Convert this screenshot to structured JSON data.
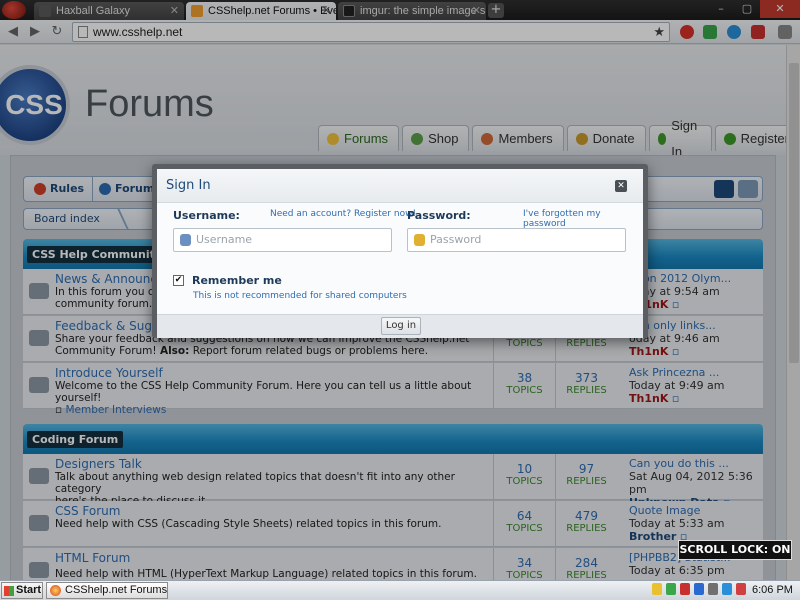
{
  "browser": {
    "tabs": [
      {
        "title": "Haxball Galaxy",
        "favicon_color": "#5a5a5a"
      },
      {
        "title": "CSShelp.net Forums • Every",
        "favicon_color": "#f0a030"
      },
      {
        "title": "imgur: the simple image sh",
        "favicon_color": "#222222"
      }
    ],
    "new_tab_symbol": "+",
    "window_controls": {
      "minimize": "–",
      "maximize": "▢",
      "close": "✕"
    },
    "nav": {
      "back": "◀",
      "forward": "▶",
      "reload": "↻"
    },
    "url": "www.csshelp.net",
    "star_symbol": "★"
  },
  "site": {
    "logo_badge": "CSS",
    "logo_text": "Forums",
    "nav": [
      {
        "label": "Forums",
        "icon": "chat-icon",
        "color": "#f2c33a"
      },
      {
        "label": "Shop",
        "icon": "tag-icon",
        "color": "#5aa04a"
      },
      {
        "label": "Members",
        "icon": "members-icon",
        "color": "#d06a3a"
      },
      {
        "label": "Donate",
        "icon": "coins-icon",
        "color": "#c89a2a"
      },
      {
        "label": "Sign In",
        "icon": "check-icon",
        "color": "#3c9a2a"
      },
      {
        "label": "Register",
        "icon": "plus-icon",
        "color": "#3c9a2a"
      }
    ],
    "subnav": {
      "rules": "Rules",
      "forum": "Forum"
    },
    "breadcrumb": "Board index"
  },
  "categories": [
    {
      "title": "CSS Help Community F",
      "forums": [
        {
          "name": "News & Announcem",
          "desc": "In this forum you can",
          "desc2": "community forum.",
          "topics": "",
          "replies": "",
          "last_title": "ndon 2012 Olym...",
          "last_when": "oday at 9:54 am",
          "last_user": "Th1nK"
        },
        {
          "name": "Feedback & Sugges",
          "desc": "Share your feedback and suggestions on how we can improve the CSShelp.net",
          "desc2": "Community Forum!",
          "also_label": "Also:",
          "also_text": "Report forum related bugs or problems here.",
          "topics": "20",
          "replies": "157",
          "last_title": "min only links...",
          "last_when": "oday at 9:46 am",
          "last_user": "Th1nK"
        },
        {
          "name": "Introduce Yourself",
          "desc": "Welcome to the CSS Help Community Forum. Here you can tell us a little about yourself!",
          "subforum": "Member Interviews",
          "topics": "38",
          "replies": "373",
          "last_title": "Ask Princezna ...",
          "last_when": "Today at 9:49 am",
          "last_user": "Th1nK"
        }
      ]
    },
    {
      "title": "Coding Forum",
      "forums": [
        {
          "name": "Designers Talk",
          "desc": "Talk about anything web design related topics that doesn't fit into any other category",
          "desc2": "here's the place to discuss it.",
          "topics": "10",
          "replies": "97",
          "last_title": "Can you do this ...",
          "last_when": "Sat Aug 04, 2012 5:36 pm",
          "last_user": "Unknown Data"
        },
        {
          "name": "CSS Forum",
          "desc": "Need help with CSS (Cascading Style Sheets) related topics in this forum.",
          "topics": "64",
          "replies": "479",
          "last_title": "Quote Image",
          "last_when": "Today at 5:33 am",
          "last_user": "Brother"
        },
        {
          "name": "HTML Forum",
          "desc": "Need help with HTML (HyperText Markup Language) related topics in this forum.",
          "topics": "34",
          "replies": "284",
          "last_title": "[PHPBB2] Statist...",
          "last_when": "Today at 6:35 pm",
          "last_user": ""
        }
      ]
    }
  ],
  "labels": {
    "topics": "TOPICS",
    "replies": "REPLIES"
  },
  "modal": {
    "title": "Sign In",
    "close_symbol": "✕",
    "username_label": "Username:",
    "register_link": "Need an account? Register now!",
    "username_placeholder": "Username",
    "password_label": "Password:",
    "forgot_link": "I've forgotten my password",
    "password_placeholder": "Password",
    "remember_label": "Remember me",
    "remember_checked": "✔",
    "remember_note": "This is not recommended for shared computers",
    "login_button": "Log in"
  },
  "scroll_lock": "SCROLL LOCK: ON",
  "taskbar": {
    "start": "Start",
    "task_title": "CSShelp.net Forums • ...",
    "clock": "6:06 PM"
  }
}
